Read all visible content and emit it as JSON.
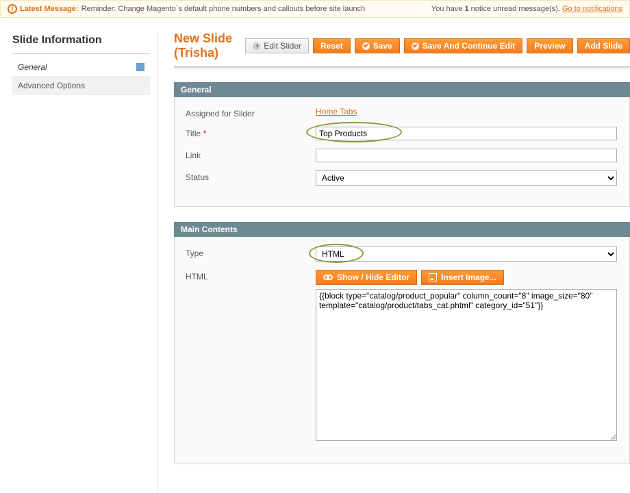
{
  "notice": {
    "latest_label": "Latest Message:",
    "message": "Reminder: Change Magento`s default phone numbers and callouts before site launch",
    "unread_prefix": "You have ",
    "unread_count": "1",
    "unread_suffix": " notice unread message(s). ",
    "link": "Go to notifications"
  },
  "sidebar": {
    "title": "Slide Information",
    "tabs": [
      "General",
      "Advanced Options"
    ]
  },
  "header": {
    "title": "New Slide (Trisha)",
    "buttons": {
      "edit_slider": "Edit Slider",
      "reset": "Reset",
      "save": "Save",
      "save_continue": "Save And Continue Edit",
      "preview": "Preview",
      "add_slide": "Add Slide"
    }
  },
  "general": {
    "legend": "General",
    "assigned_label": "Assigned for Slider",
    "assigned_link": "Home Tabs",
    "title_label": "Title",
    "title_value": "Top Products",
    "link_label": "Link",
    "link_value": "",
    "status_label": "Status",
    "status_value": "Active"
  },
  "main_contents": {
    "legend": "Main Contents",
    "type_label": "Type",
    "type_value": "HTML",
    "html_label": "HTML",
    "show_hide": "Show / Hide Editor",
    "insert_image": "Insert Image...",
    "html_value": "{{block type=\"catalog/product_popular\" column_count=\"8\" image_size=\"80\" template=\"catalog/product/tabs_cat.phtml\" category_id=\"51\"}}"
  }
}
